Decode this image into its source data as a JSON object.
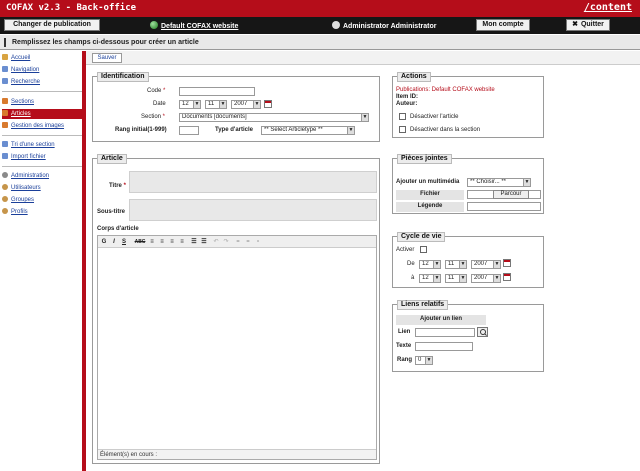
{
  "header": {
    "app_title": "COFAX v2.3 - Back-office",
    "content_link": "/content",
    "publication_button": "Changer de publication",
    "site_link": "Default COFAX website",
    "user": "Administrator Administrator",
    "account_button": "Mon compte",
    "quit_button": "Quitter"
  },
  "infobar": {
    "message": "Remplissez les champs ci-dessous pour créer un article"
  },
  "sidebar": {
    "items": [
      {
        "label": "Accueil",
        "icon": "home-icon"
      },
      {
        "label": "Navigation",
        "icon": "navigation-icon"
      },
      {
        "label": "Recherche",
        "icon": "search-icon"
      },
      {
        "label": "Sections",
        "icon": "sections-icon"
      },
      {
        "label": "Articles",
        "icon": "articles-icon",
        "active": true
      },
      {
        "label": "Gestion des images",
        "icon": "images-icon"
      },
      {
        "label": "Tri d'une section",
        "icon": "sort-icon"
      },
      {
        "label": "Import fichier",
        "icon": "import-icon"
      },
      {
        "label": "Administration",
        "icon": "admin-gear-icon"
      },
      {
        "label": "Utilisateurs",
        "icon": "users-icon"
      },
      {
        "label": "Groupes",
        "icon": "groups-icon"
      },
      {
        "label": "Profils",
        "icon": "profiles-icon"
      }
    ]
  },
  "toolbar": {
    "save_label": "Sauver"
  },
  "identification": {
    "legend": "Identification",
    "code_label": "Code",
    "date_label": "Date",
    "date_day": "12",
    "date_month": "11",
    "date_year": "2007",
    "section_label": "Section",
    "section_value": "Documents [documents]",
    "rank_label": "Rang initial(1-999)",
    "type_label": "Type d'article",
    "type_value": "** Select Articletype **"
  },
  "article": {
    "legend": "Article",
    "title_label": "Titre",
    "subtitle_label": "Sous-titre",
    "body_label": "Corps d'article",
    "toolbar_buttons": [
      "G",
      "I",
      "S",
      "ABC",
      "≡",
      "≡",
      "≡",
      "≡",
      "☰",
      "☰",
      "↶",
      "↷",
      "⚭",
      "⚭",
      "⚬"
    ],
    "status": "Élément(s) en cours :"
  },
  "actions": {
    "legend": "Actions",
    "publications": "Publications: Default COFAX website",
    "item_id": "Item ID:",
    "author": "Auteur:",
    "disable_article": "Désactiver l'article",
    "disable_in_section": "Désactiver dans la section"
  },
  "attachments": {
    "legend": "Pièces jointes",
    "add_media_label": "Ajouter un multimédia",
    "add_media_value": "** Choisir... **",
    "file_label": "Fichier",
    "browse_button": "Parcour",
    "caption_label": "Légende"
  },
  "lifecycle": {
    "legend": "Cycle de vie",
    "active_label": "Activer",
    "from_label": "De",
    "to_label": "à",
    "from_day": "12",
    "from_month": "11",
    "from_year": "2007",
    "to_day": "12",
    "to_month": "11",
    "to_year": "2007"
  },
  "links": {
    "legend": "Liens relatifs",
    "add_link": "Ajouter un lien",
    "link_label": "Lien",
    "text_label": "Texte",
    "rank_label": "Rang",
    "rank_value": "0"
  }
}
